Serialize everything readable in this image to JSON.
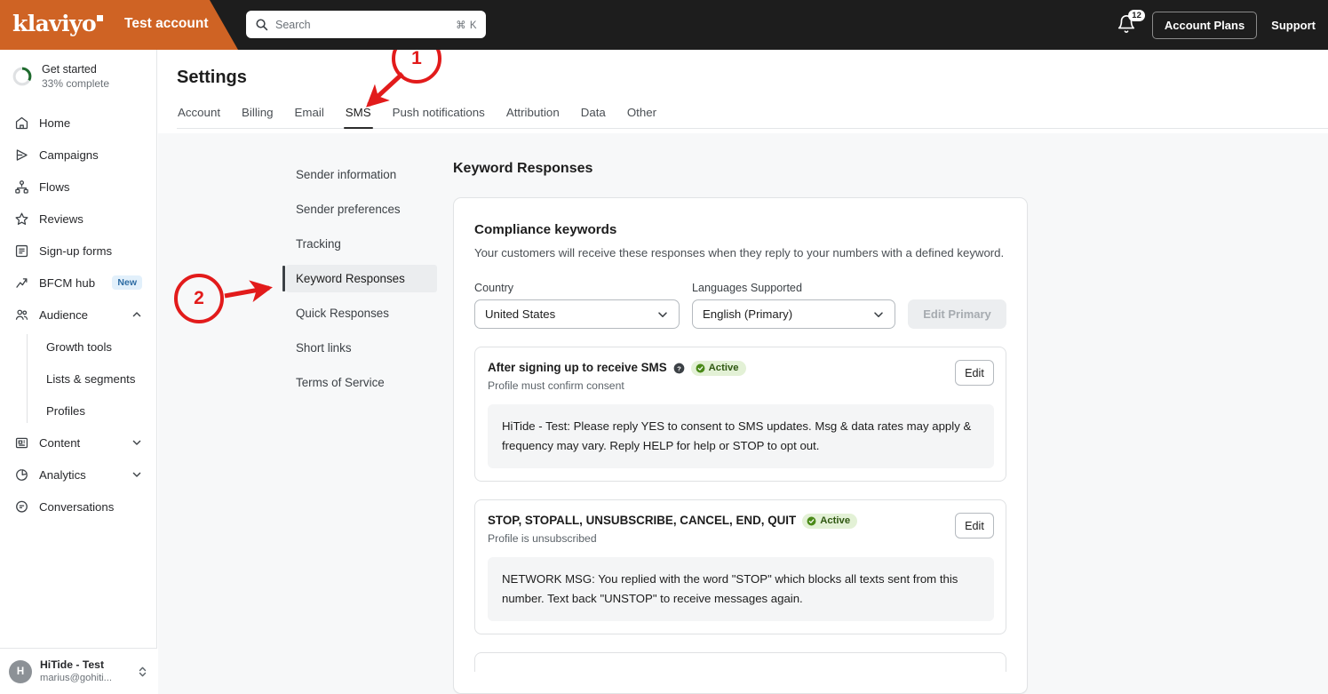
{
  "topbar": {
    "logo": "klaviyo",
    "account_name": "Test account",
    "search_placeholder": "Search",
    "search_shortcut": "⌘ K",
    "notification_count": "12",
    "account_plans_label": "Account Plans",
    "support_label": "Support",
    "orange_hex": "#cf6324",
    "dark_hex": "#1d1d1d"
  },
  "sidebar": {
    "get_started": {
      "title": "Get started",
      "progress_text": "33% complete",
      "progress_pct": 33
    },
    "items": [
      {
        "label": "Home",
        "icon": "home-icon"
      },
      {
        "label": "Campaigns",
        "icon": "send-icon"
      },
      {
        "label": "Flows",
        "icon": "flows-icon"
      },
      {
        "label": "Reviews",
        "icon": "star-icon"
      },
      {
        "label": "Sign-up forms",
        "icon": "form-icon"
      },
      {
        "label": "BFCM hub",
        "icon": "trending-up-icon",
        "badge": "New"
      },
      {
        "label": "Audience",
        "icon": "people-icon",
        "expanded": true
      }
    ],
    "audience_children": [
      {
        "label": "Growth tools"
      },
      {
        "label": "Lists & segments"
      },
      {
        "label": "Profiles"
      }
    ],
    "items_bottom": [
      {
        "label": "Content",
        "icon": "content-icon",
        "collapsible": true
      },
      {
        "label": "Analytics",
        "icon": "pie-chart-icon",
        "collapsible": true
      },
      {
        "label": "Conversations",
        "icon": "chat-icon",
        "collapsible": false
      }
    ],
    "footer": {
      "initial": "H",
      "name": "HiTide - Test",
      "email": "marius@gohiti..."
    }
  },
  "page": {
    "title": "Settings",
    "tabs": [
      {
        "label": "Account",
        "active": false
      },
      {
        "label": "Billing",
        "active": false
      },
      {
        "label": "Email",
        "active": false
      },
      {
        "label": "SMS",
        "active": true
      },
      {
        "label": "Push notifications",
        "active": false
      },
      {
        "label": "Attribution",
        "active": false
      },
      {
        "label": "Data",
        "active": false
      },
      {
        "label": "Other",
        "active": false
      }
    ]
  },
  "subnav": [
    {
      "label": "Sender information",
      "active": false
    },
    {
      "label": "Sender preferences",
      "active": false
    },
    {
      "label": "Tracking",
      "active": false
    },
    {
      "label": "Keyword Responses",
      "active": true
    },
    {
      "label": "Quick Responses",
      "active": false
    },
    {
      "label": "Short links",
      "active": false
    },
    {
      "label": "Terms of Service",
      "active": false
    }
  ],
  "panel": {
    "title": "Keyword Responses",
    "card_heading": "Compliance keywords",
    "card_description": "Your customers will receive these responses when they reply to your numbers with a defined keyword.",
    "country_label": "Country",
    "country_value": "United States",
    "languages_label": "Languages Supported",
    "languages_value": "English (Primary)",
    "edit_primary_label": "Edit Primary",
    "edit_primary_disabled": true,
    "keyword_cards": [
      {
        "title": "After signing up to receive SMS",
        "has_help_icon": true,
        "status": "Active",
        "subtitle": "Profile must confirm consent",
        "edit_label": "Edit",
        "message": "HiTide - Test: Please reply YES to consent to SMS updates. Msg & data rates may apply & frequency may vary. Reply HELP for help or STOP to opt out."
      },
      {
        "title": "STOP, STOPALL, UNSUBSCRIBE, CANCEL, END, QUIT",
        "has_help_icon": false,
        "status": "Active",
        "subtitle": "Profile is unsubscribed",
        "edit_label": "Edit",
        "message": "NETWORK MSG: You replied with the word \"STOP\" which blocks all texts sent from this number. Text back \"UNSTOP\" to receive messages again."
      }
    ]
  },
  "annotations": {
    "color": "#e21b1b",
    "markers": [
      {
        "number": "1",
        "target": "SMS tab"
      },
      {
        "number": "2",
        "target": "Keyword Responses subnav item"
      }
    ]
  }
}
